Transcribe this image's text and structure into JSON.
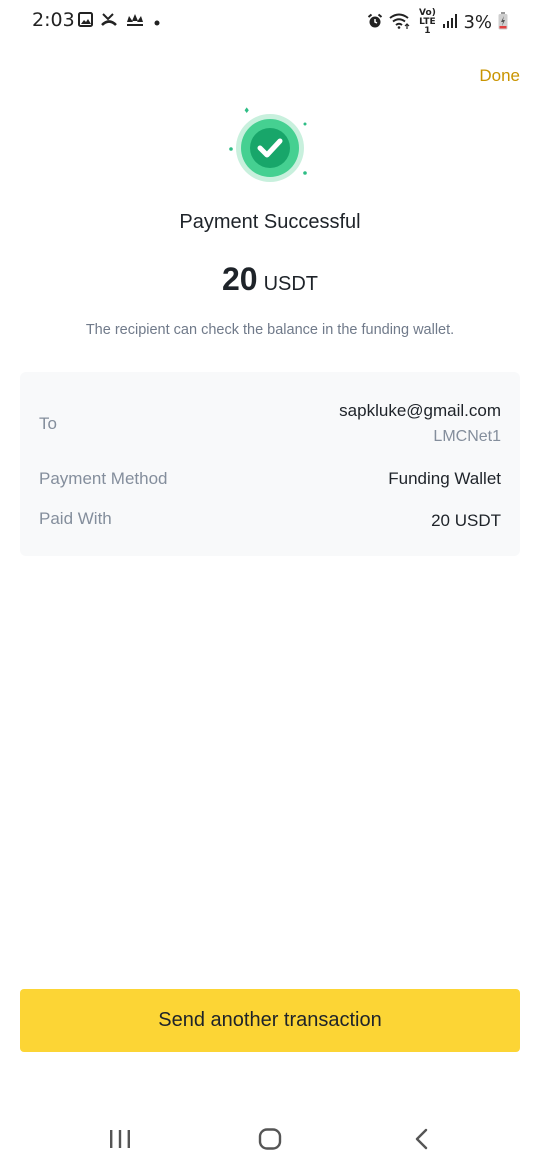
{
  "status_bar": {
    "time": "2:03",
    "battery": "3%",
    "network_label": "Vo) LTE1",
    "left_icons": [
      "gallery-icon",
      "missed-call-icon",
      "brand-notification-icon",
      "dot-icon"
    ],
    "right_icons": [
      "alarm-icon",
      "wifi-icon",
      "signal-icon",
      "battery-charging-icon"
    ]
  },
  "header": {
    "done_label": "Done"
  },
  "result": {
    "title": "Payment Successful",
    "amount_value": "20",
    "amount_unit": "USDT",
    "subtitle": "The recipient can check the balance in the funding wallet."
  },
  "details": {
    "to_label": "To",
    "to_value": "sapkluke@gmail.com",
    "to_sub": "LMCNet1",
    "method_label": "Payment Method",
    "method_value": "Funding Wallet",
    "paid_label": "Paid With",
    "paid_value": "20 USDT"
  },
  "action": {
    "send_another_label": "Send another transaction"
  },
  "colors": {
    "accent": "#fcd535",
    "done_text": "#c99400",
    "success_green": "#2ebd85",
    "secondary_text": "#848e9c"
  },
  "nav": {
    "icons": [
      "recent-apps-icon",
      "home-icon",
      "back-icon"
    ]
  }
}
